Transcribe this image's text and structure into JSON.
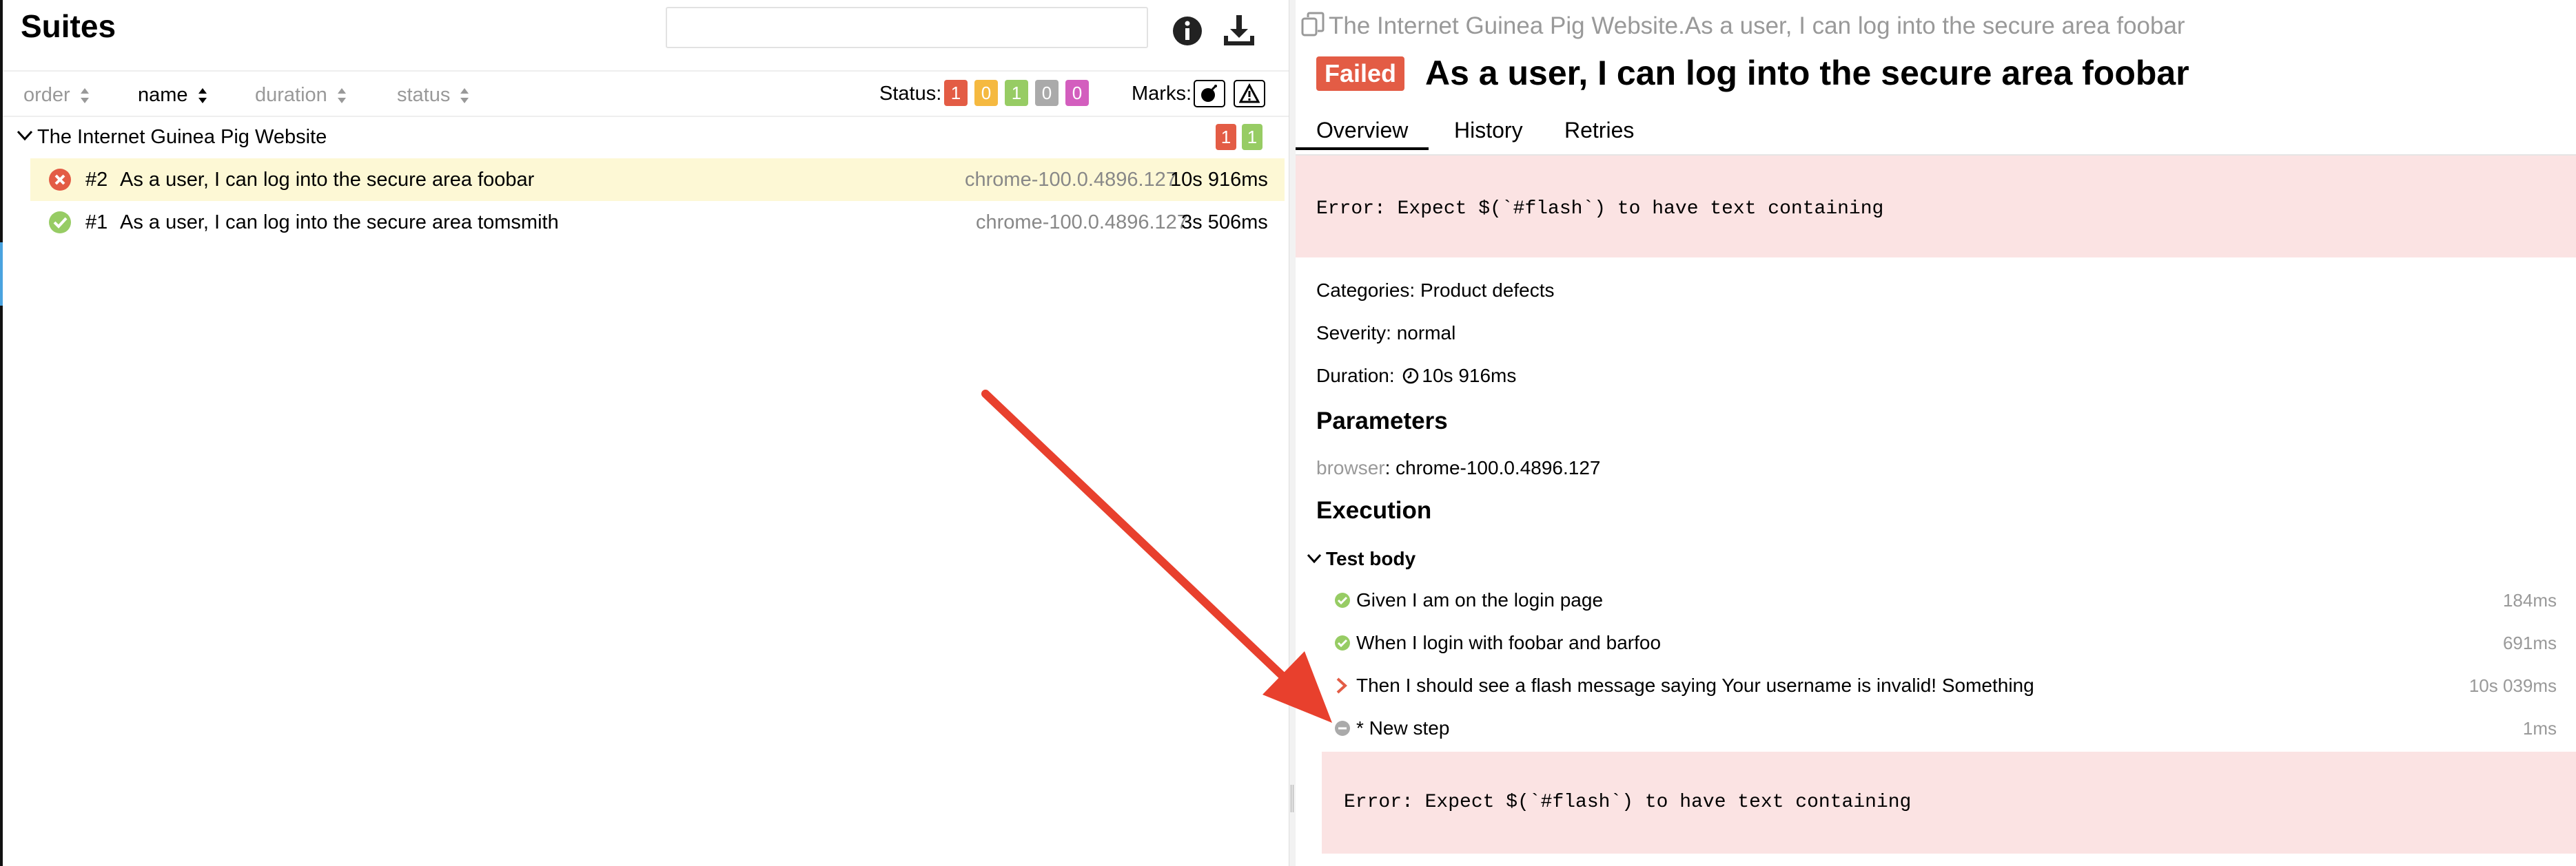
{
  "left": {
    "title": "Suites",
    "search": {
      "value": "",
      "placeholder": ""
    },
    "sort": [
      {
        "label": "order",
        "active": false
      },
      {
        "label": "name",
        "active": true
      },
      {
        "label": "duration",
        "active": false
      },
      {
        "label": "status",
        "active": false
      }
    ],
    "status_label": "Status:",
    "status_counts": [
      {
        "value": "1",
        "color": "#e35c45"
      },
      {
        "value": "0",
        "color": "#f5b940"
      },
      {
        "value": "1",
        "color": "#97cc64"
      },
      {
        "value": "0",
        "color": "#aaaaaa"
      },
      {
        "value": "0",
        "color": "#d35ebe"
      }
    ],
    "marks_label": "Marks:",
    "suite": {
      "name": "The Internet Guinea Pig Website",
      "counts": [
        {
          "value": "1",
          "color": "#e35c45"
        },
        {
          "value": "1",
          "color": "#97cc64"
        }
      ]
    },
    "tests": [
      {
        "num": "#2",
        "name": "As a user, I can log into the secure area foobar",
        "env": "chrome-100.0.4896.127",
        "duration": "10s 916ms",
        "status": "failed"
      },
      {
        "num": "#1",
        "name": "As a user, I can log into the secure area tomsmith",
        "env": "chrome-100.0.4896.127",
        "duration": "3s 506ms",
        "status": "passed"
      }
    ]
  },
  "right": {
    "breadcrumb": "The Internet Guinea Pig Website.As a user, I can log into the secure area foobar",
    "status_badge": "Failed",
    "title": "As a user, I can log into the secure area foobar",
    "tabs": [
      "Overview",
      "History",
      "Retries"
    ],
    "error": "Error: Expect $(`#flash`) to have text containing",
    "categories_label": "Categories:",
    "categories_value": "Product defects",
    "severity_label": "Severity:",
    "severity_value": "normal",
    "duration_label": "Duration:",
    "duration_value": "10s 916ms",
    "parameters_heading": "Parameters",
    "param_key": "browser",
    "param_sep": ":",
    "param_value": "chrome-100.0.4896.127",
    "execution_heading": "Execution",
    "test_body_label": "Test body",
    "steps": [
      {
        "name": "Given I am on the login page",
        "duration": "184ms",
        "status": "passed"
      },
      {
        "name": "When I login with foobar and barfoo",
        "duration": "691ms",
        "status": "passed"
      },
      {
        "name": "Then I should see a flash message saying Your username is invalid! Something",
        "duration": "10s 039ms",
        "status": "failed"
      },
      {
        "name": "* New step",
        "duration": "1ms",
        "status": "skipped"
      }
    ],
    "step_error": "Error: Expect $(`#flash`) to have text containing"
  },
  "colors": {
    "failed": "#e35c45",
    "passed": "#97cc64",
    "skipped": "#aaaaaa",
    "annotation_arrow": "#e8402d"
  }
}
